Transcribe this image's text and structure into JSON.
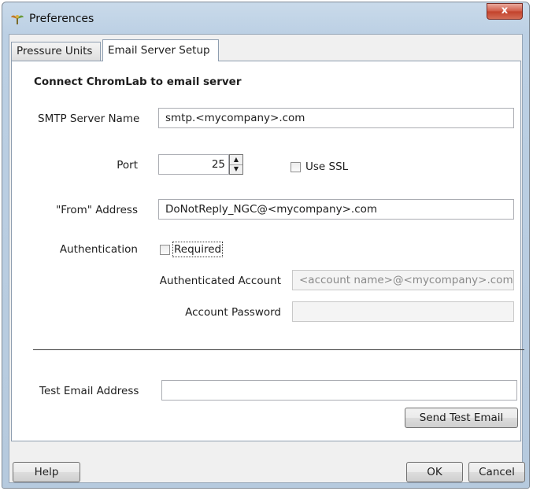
{
  "window": {
    "title": "Preferences",
    "close_glyph": "x"
  },
  "tabs": [
    {
      "label": "Pressure Units",
      "active": false
    },
    {
      "label": "Email Server Setup",
      "active": true
    }
  ],
  "email_setup": {
    "heading": "Connect ChromLab to email server",
    "smtp_label": "SMTP Server Name",
    "smtp_value": "smtp.<mycompany>.com",
    "port_label": "Port",
    "port_value": "25",
    "ssl_label": "Use SSL",
    "ssl_checked": false,
    "from_label": "\"From\" Address",
    "from_value": "DoNotReply_NGC@<mycompany>.com",
    "auth_label": "Authentication",
    "required_label": "Required",
    "required_checked": false,
    "account_label": "Authenticated Account",
    "account_placeholder": "<account name>@<mycompany>.com",
    "password_label": "Account Password",
    "password_value": "",
    "test_label": "Test Email Address",
    "test_value": "",
    "send_test_label": "Send Test Email"
  },
  "footer": {
    "help_label": "Help",
    "ok_label": "OK",
    "cancel_label": "Cancel"
  },
  "icons": {
    "app": "preferences-app-icon",
    "close": "close-icon",
    "spin_up": "spin-up-arrow-icon",
    "spin_down": "spin-down-arrow-icon"
  },
  "colors": {
    "titlebar": "#c4d6ea",
    "close_button": "#c94a34",
    "panel": "#ffffff",
    "separator": "#3c3c3c"
  }
}
